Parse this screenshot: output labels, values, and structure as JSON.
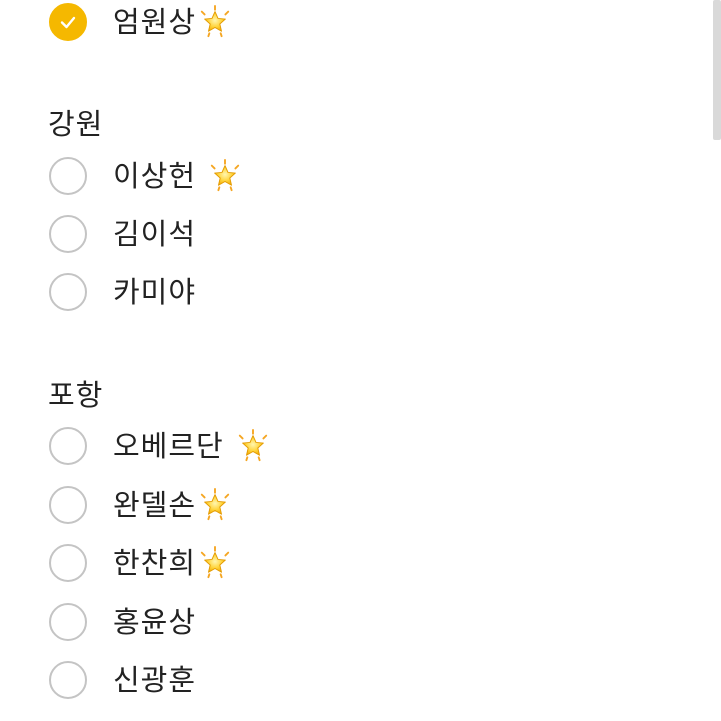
{
  "accent_color": "#f5b800",
  "star_icon": "glowing-star-icon",
  "top_option": {
    "label": "엄원상",
    "checked": true,
    "star": true
  },
  "groups": [
    {
      "heading": "강원",
      "options": [
        {
          "label": "이상헌",
          "star": true
        },
        {
          "label": "김이석",
          "star": false
        },
        {
          "label": "카미야",
          "star": false
        }
      ]
    },
    {
      "heading": "포항",
      "options": [
        {
          "label": "오베르단",
          "star": true
        },
        {
          "label": "완델손",
          "star": true
        },
        {
          "label": "한찬희",
          "star": true
        },
        {
          "label": "홍윤상",
          "star": false
        },
        {
          "label": "신광훈",
          "star": false
        }
      ]
    }
  ]
}
